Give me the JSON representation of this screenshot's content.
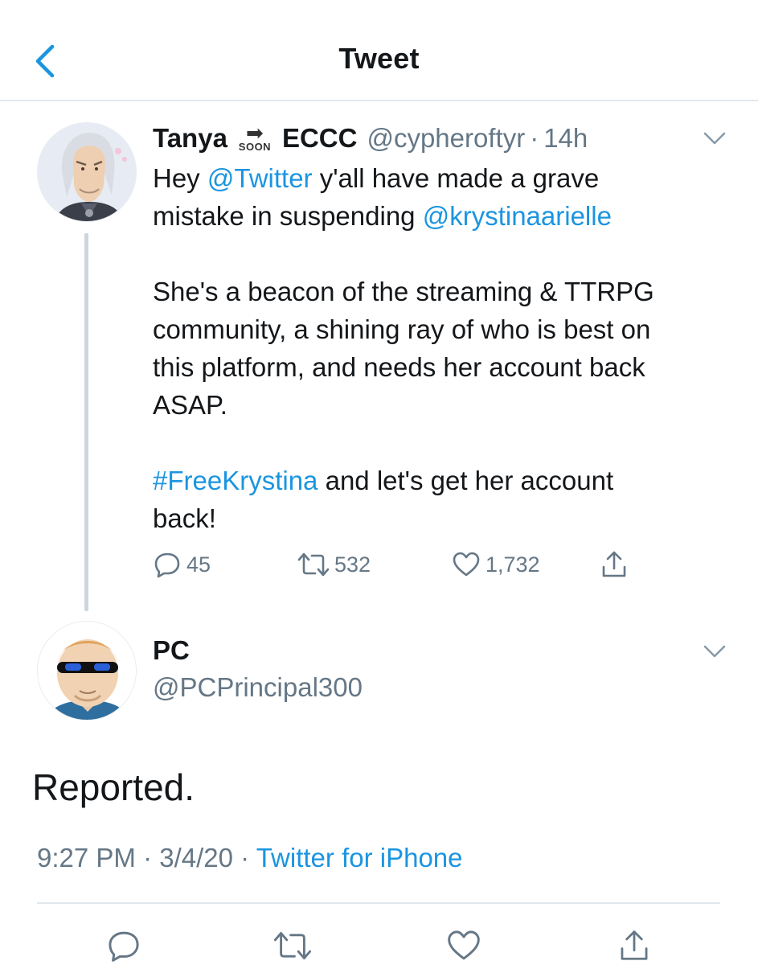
{
  "header": {
    "title": "Tweet"
  },
  "parent_tweet": {
    "display_name": "Tanya",
    "emoji_text": "SOON",
    "display_name_suffix": "ECCC",
    "handle": "@cypheroftyr",
    "separator": "·",
    "time": "14h",
    "body": {
      "line1_a": "Hey ",
      "mention_twitter": "@Twitter",
      "line1_b": " y'all have made a grave\nmistake in suspending ",
      "mention_krystina": "@krystinaarielle",
      "paragraph2": "\n\nShe's a beacon of the streaming & TTRPG\ncommunity, a shining ray of who is best on\nthis platform, and needs her account back\nASAP.\n\n",
      "hashtag": "#FreeKrystina",
      "paragraph3": " and let's get her account\nback!"
    },
    "stats": {
      "replies": "45",
      "retweets": "532",
      "likes": "1,732"
    }
  },
  "reply_tweet": {
    "display_name": "PC",
    "handle": "@PCPrincipal300",
    "text": "Reported.",
    "time": "9:27 PM",
    "separator1": " · ",
    "date": "3/4/20",
    "separator2": " · ",
    "source": "Twitter for iPhone"
  },
  "colors": {
    "link_blue": "#1b95e0",
    "secondary_gray": "#657786",
    "divider": "#e1e8ed",
    "text": "#14171a"
  },
  "icons": {
    "back": "chevron-left-icon",
    "caret": "chevron-down-icon",
    "reply": "reply-icon",
    "retweet": "retweet-icon",
    "like": "heart-icon",
    "share": "share-icon"
  }
}
